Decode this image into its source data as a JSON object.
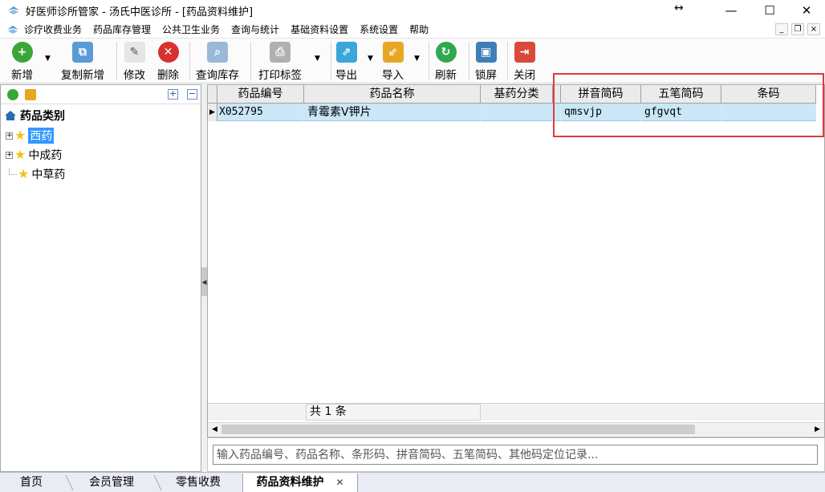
{
  "window": {
    "title": "好医师诊所管家 - 汤氏中医诊所 - [药品资料维护]",
    "resize_glyph": "↔",
    "minimize": "—",
    "maximize": "☐",
    "close": "✕"
  },
  "menu": {
    "items": [
      "诊疗收费业务",
      "药品库存管理",
      "公共卫生业务",
      "查询与统计",
      "基础资料设置",
      "系统设置",
      "帮助"
    ],
    "mdi_minimize": "_",
    "mdi_restore": "❐",
    "mdi_close": "×"
  },
  "toolbar": {
    "add": "新增",
    "copy_add": "复制新增",
    "edit": "修改",
    "delete": "删除",
    "query_stock": "查询库存",
    "print_label": "打印标签",
    "export": "导出",
    "import": "导入",
    "refresh": "刷新",
    "lock": "锁屏",
    "close": "关闭",
    "dropdown_arrow": "▼"
  },
  "tree": {
    "root": "药品类别",
    "items": [
      {
        "label": "西药",
        "selected": true,
        "expandable": true
      },
      {
        "label": "中成药",
        "selected": false,
        "expandable": true
      },
      {
        "label": "中草药",
        "selected": false,
        "expandable": false
      }
    ],
    "expand_all": "+",
    "collapse_all": "−"
  },
  "grid": {
    "columns": [
      "药品编号",
      "药品名称",
      "基药分类",
      "拼音简码",
      "五笔简码",
      "条码"
    ],
    "rows": [
      {
        "code": "X052795",
        "name": "青霉素V钾片",
        "category": "",
        "pinyin": "qmsvjp",
        "wubi": "gfgvqt",
        "barcode": "",
        "indicator": "▶"
      }
    ],
    "footer_count": "共 1 条",
    "scroll_left": "◀",
    "scroll_right": "▶"
  },
  "search": {
    "placeholder": "输入药品编号、药品名称、条形码、拼音简码、五笔简码、其他码定位记录..."
  },
  "tabs": {
    "items": [
      "首页",
      "会员管理",
      "零售收费",
      "药品资料维护"
    ],
    "close": "✕",
    "active_index": 3
  },
  "colors": {
    "selection": "#3399ff",
    "row_highlight": "#c9e7f7",
    "annotation_box": "#e03a3a"
  }
}
